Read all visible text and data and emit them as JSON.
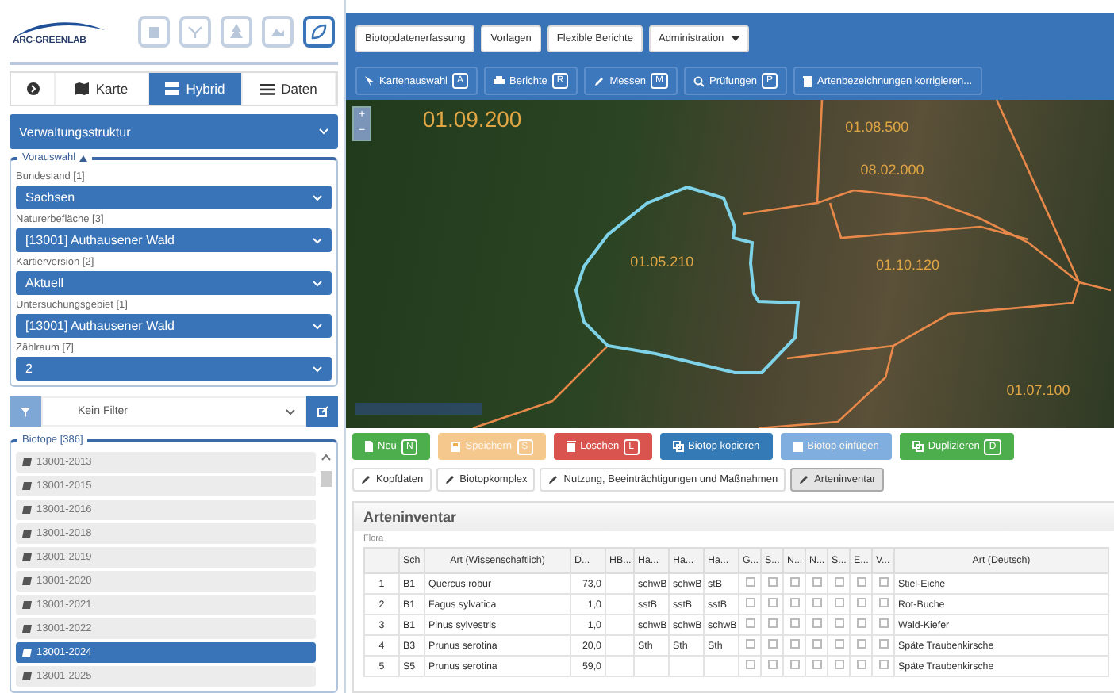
{
  "logo": {
    "text": "ARC-GREENLAB"
  },
  "header_icons": [
    {
      "selected": false
    },
    {
      "selected": false
    },
    {
      "selected": false
    },
    {
      "selected": false
    },
    {
      "selected": true
    }
  ],
  "view_tabs": [
    {
      "kind": "icon",
      "selected": false
    },
    {
      "kind": "map",
      "label": "Karte",
      "selected": false
    },
    {
      "kind": "hybrid",
      "label": "Hybrid",
      "selected": true
    },
    {
      "kind": "data",
      "label": "Daten",
      "selected": false
    }
  ],
  "structure_select": {
    "value": "Verwaltungsstruktur"
  },
  "preselection": {
    "legend": "Vorauswahl",
    "expanded": true,
    "fields": [
      {
        "label": "Bundesland [1]",
        "value": "Sachsen"
      },
      {
        "label": "Naturerbefläche [3]",
        "value": "[13001] Authausener Wald"
      },
      {
        "label": "Kartierversion [2]",
        "value": "Aktuell"
      },
      {
        "label": "Untersuchungsgebiet [1]",
        "value": "[13001] Authausener Wald"
      },
      {
        "label": "Zählraum [7]",
        "value": "2"
      }
    ]
  },
  "filter": {
    "value": "Kein Filter"
  },
  "biotopes": {
    "legend": "Biotope [386]",
    "items": [
      {
        "label": "13001-2013",
        "selected": false
      },
      {
        "label": "13001-2015",
        "selected": false
      },
      {
        "label": "13001-2016",
        "selected": false
      },
      {
        "label": "13001-2018",
        "selected": false
      },
      {
        "label": "13001-2019",
        "selected": false
      },
      {
        "label": "13001-2020",
        "selected": false
      },
      {
        "label": "13001-2021",
        "selected": false
      },
      {
        "label": "13001-2022",
        "selected": false
      },
      {
        "label": "13001-2024",
        "selected": true
      },
      {
        "label": "13001-2025",
        "selected": false
      }
    ]
  },
  "menu": [
    {
      "label": "Biotopdatenerfassung",
      "dropdown": false
    },
    {
      "label": "Vorlagen",
      "dropdown": false
    },
    {
      "label": "Flexible Berichte",
      "dropdown": false
    },
    {
      "label": "Administration",
      "dropdown": true
    }
  ],
  "toolbar": [
    {
      "kind": "pointer",
      "label": "Kartenauswahl",
      "key": "A"
    },
    {
      "kind": "print",
      "label": "Berichte",
      "key": "R"
    },
    {
      "kind": "pencil",
      "label": "Messen",
      "key": "M"
    },
    {
      "kind": "search",
      "label": "Prüfungen",
      "key": "P"
    },
    {
      "kind": "trash",
      "label": "Artenbezeichnungen korrigieren..."
    }
  ],
  "map": {
    "zoom_in": "+",
    "zoom_out": "−",
    "labels": [
      {
        "text": "01.09.200"
      },
      {
        "text": "01.08.500"
      },
      {
        "text": "08.02.000"
      },
      {
        "text": "01.05.210"
      },
      {
        "text": "01.10.120"
      },
      {
        "text": "01.07.100"
      }
    ]
  },
  "actions": [
    {
      "kind": "new",
      "label": "Neu",
      "key": "N",
      "color": "#4cae4c",
      "disabled": false
    },
    {
      "kind": "save",
      "label": "Speichern",
      "key": "S",
      "color": "#f5c98e",
      "disabled": true
    },
    {
      "kind": "delete",
      "label": "Löschen",
      "key": "L",
      "color": "#d9534f",
      "disabled": false
    },
    {
      "kind": "copy",
      "label": "Biotop kopieren",
      "color": "#337ab7",
      "disabled": false
    },
    {
      "kind": "paste",
      "label": "Biotop einfügen",
      "color": "#80aede",
      "disabled": true
    },
    {
      "kind": "copy",
      "label": "Duplizieren",
      "key": "D",
      "color": "#4cae4c",
      "disabled": false
    }
  ],
  "detail_tabs": [
    {
      "label": "Kopfdaten",
      "selected": false
    },
    {
      "label": "Biotopkomplex",
      "selected": false
    },
    {
      "label": "Nutzung, Beeinträchtigungen und Maßnahmen",
      "selected": false
    },
    {
      "label": "Arteninventar",
      "selected": true
    }
  ],
  "panel": {
    "title": "Arteninventar",
    "section": "Flora"
  },
  "table": {
    "columns": [
      "",
      "Sch",
      "Art (Wissenschaftlich)",
      "D...",
      "HB...",
      "Ha...",
      "Ha...",
      "Ha...",
      "G...",
      "S...",
      "N...",
      "N...",
      "S...",
      "E...",
      "V...",
      "Art (Deutsch)"
    ],
    "rows": [
      {
        "cells": [
          "1",
          "B1",
          "Quercus robur",
          "73,0",
          "",
          "schwB",
          "schwB",
          "stB"
        ],
        "checks": [
          false,
          false,
          false,
          false,
          false,
          false,
          false
        ],
        "german": "Stiel-Eiche"
      },
      {
        "cells": [
          "2",
          "B1",
          "Fagus sylvatica",
          "1,0",
          "",
          "sstB",
          "sstB",
          "sstB"
        ],
        "checks": [
          false,
          false,
          false,
          false,
          false,
          false,
          false
        ],
        "german": "Rot-Buche"
      },
      {
        "cells": [
          "3",
          "B1",
          "Pinus sylvestris",
          "1,0",
          "",
          "schwB",
          "schwB",
          "schwB"
        ],
        "checks": [
          false,
          false,
          false,
          false,
          false,
          false,
          false
        ],
        "german": "Wald-Kiefer"
      },
      {
        "cells": [
          "4",
          "B3",
          "Prunus serotina",
          "20,0",
          "",
          "Sth",
          "Sth",
          "Sth"
        ],
        "checks": [
          false,
          false,
          false,
          false,
          false,
          false,
          false
        ],
        "german": "Späte Traubenkirsche"
      },
      {
        "cells": [
          "5",
          "S5",
          "Prunus serotina",
          "59,0",
          "",
          "",
          "",
          ""
        ],
        "checks": [
          false,
          false,
          false,
          false,
          false,
          false,
          false
        ],
        "german": "Späte Traubenkirsche"
      }
    ]
  }
}
